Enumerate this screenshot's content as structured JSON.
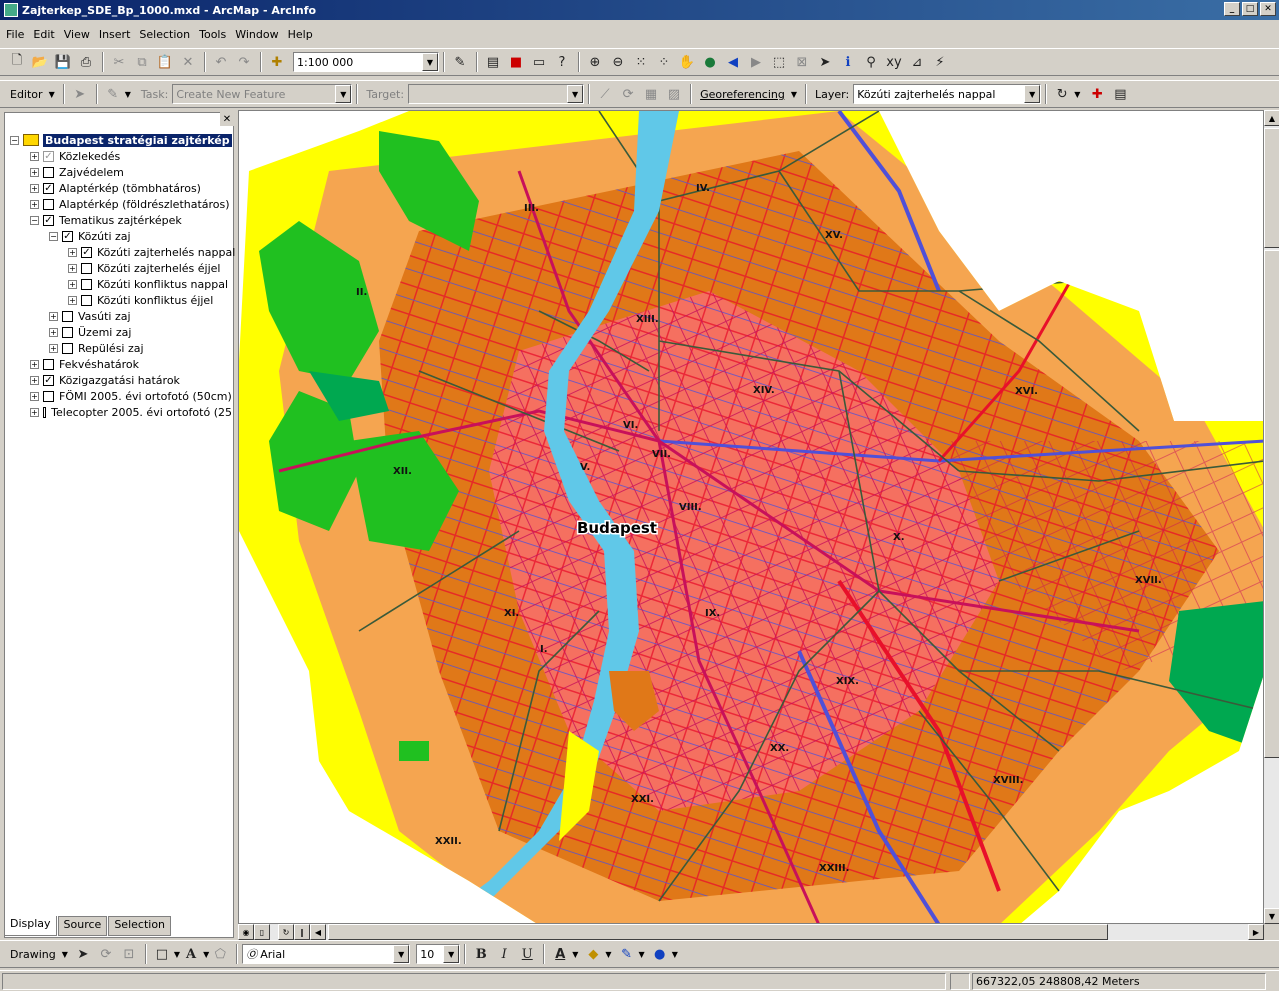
{
  "window": {
    "title": "Zajterkep_SDE_Bp_1000.mxd - ArcMap - ArcInfo"
  },
  "menu": [
    "File",
    "Edit",
    "View",
    "Insert",
    "Selection",
    "Tools",
    "Window",
    "Help"
  ],
  "standard_toolbar": {
    "scale": "1:100 000"
  },
  "editor_toolbar": {
    "editor_label": "Editor",
    "task_label": "Task:",
    "task_value": "Create New Feature",
    "target_label": "Target:",
    "target_value": "",
    "georef_label": "Georeferencing",
    "layer_label": "Layer:",
    "layer_value": "Közúti zajterhelés nappal"
  },
  "toc": {
    "root": "Budapest stratégiai zajtérkép",
    "items": [
      {
        "label": "Közlekedés",
        "checked": true,
        "gray": true
      },
      {
        "label": "Zajvédelem",
        "checked": false
      },
      {
        "label": "Alaptérkép (tömbhatáros)",
        "checked": true
      },
      {
        "label": "Alaptérkép (földrészlethatáros)",
        "checked": false
      },
      {
        "label": "Tematikus zajtérképek",
        "checked": true
      },
      {
        "label": "Közúti zaj",
        "checked": true
      },
      {
        "label": "Közúti zajterhelés nappal",
        "checked": true
      },
      {
        "label": "Közúti zajterhelés éjjel",
        "checked": false
      },
      {
        "label": "Közúti konfliktus nappal",
        "checked": false
      },
      {
        "label": "Közúti konfliktus éjjel",
        "checked": false
      },
      {
        "label": "Vasúti zaj",
        "checked": false
      },
      {
        "label": "Üzemi zaj",
        "checked": false
      },
      {
        "label": "Repülési zaj",
        "checked": false
      },
      {
        "label": "Fekvéshatárok",
        "checked": false
      },
      {
        "label": "Közigazgatási határok",
        "checked": true
      },
      {
        "label": "FÖMI 2005. évi ortofotó (50cm)",
        "checked": false
      },
      {
        "label": "Telecopter 2005. évi ortofotó (25",
        "checked": false
      }
    ],
    "tabs": [
      "Display",
      "Source",
      "Selection"
    ]
  },
  "map": {
    "city_label": "Budapest",
    "districts": [
      "I.",
      "II.",
      "III.",
      "IV.",
      "V.",
      "VI.",
      "VII.",
      "VIII.",
      "IX.",
      "X.",
      "XI.",
      "XII.",
      "XIII.",
      "XIV.",
      "XV.",
      "XVI.",
      "XVII.",
      "XVIII.",
      "XIX.",
      "XX.",
      "XXI.",
      "XXII.",
      "XXIII."
    ],
    "colors": {
      "yellow": "#ffff00",
      "light_orange": "#f5a550",
      "orange": "#e07818",
      "salmon": "#f57060",
      "red": "#e8102a",
      "magenta": "#c8105a",
      "blue_road": "#5050d8",
      "green": "#20c020",
      "dark_green": "#00a850",
      "river": "#60c8e8",
      "boundary": "#3a5a3a"
    }
  },
  "drawing_toolbar": {
    "drawing_label": "Drawing",
    "font": "Arial",
    "size": "10"
  },
  "status": {
    "coords": "667322,05  248808,42 Meters"
  }
}
